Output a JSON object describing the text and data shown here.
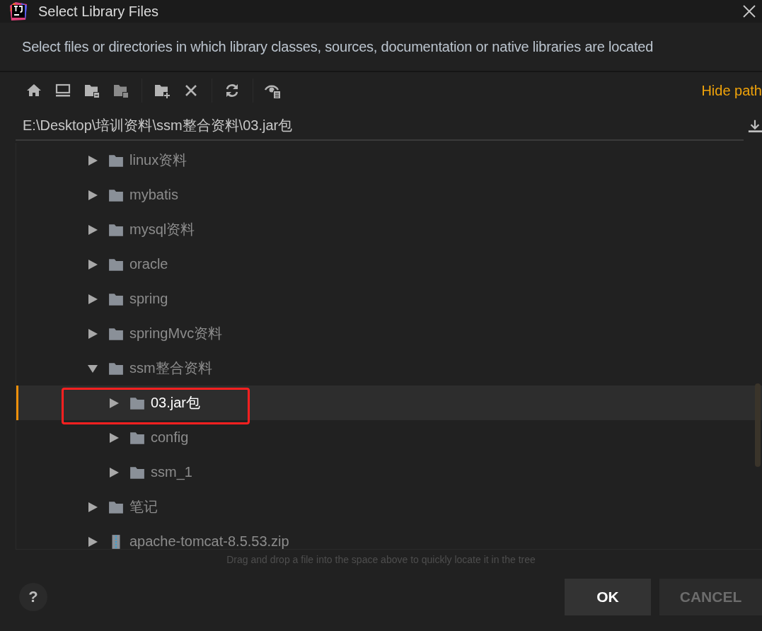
{
  "window": {
    "title": "Select Library Files"
  },
  "description": "Select files or directories in which library classes, sources, documentation or native libraries are located",
  "toolbar": {
    "hide_path_link": "Hide path"
  },
  "path_field": {
    "value": "E:\\Desktop\\培训资料\\ssm整合资料\\03.jar包"
  },
  "tree": {
    "items": [
      {
        "label": "linux资料",
        "kind": "folder",
        "expanded": false,
        "selected": false
      },
      {
        "label": "mybatis",
        "kind": "folder",
        "expanded": false,
        "selected": false
      },
      {
        "label": "mysql资料",
        "kind": "folder",
        "expanded": false,
        "selected": false
      },
      {
        "label": "oracle",
        "kind": "folder",
        "expanded": false,
        "selected": false
      },
      {
        "label": "spring",
        "kind": "folder",
        "expanded": false,
        "selected": false
      },
      {
        "label": "springMvc资料",
        "kind": "folder",
        "expanded": false,
        "selected": false
      },
      {
        "label": "ssm整合资料",
        "kind": "folder",
        "expanded": true,
        "selected": false,
        "children": [
          {
            "label": "03.jar包",
            "kind": "folder",
            "expanded": false,
            "selected": true
          },
          {
            "label": "config",
            "kind": "folder",
            "expanded": false,
            "selected": false
          },
          {
            "label": "ssm_1",
            "kind": "folder",
            "expanded": false,
            "selected": false
          }
        ]
      },
      {
        "label": "笔记",
        "kind": "folder",
        "expanded": false,
        "selected": false
      },
      {
        "label": "apache-tomcat-8.5.53.zip",
        "kind": "archive",
        "expanded": false,
        "selected": false
      }
    ]
  },
  "hint": "Drag and drop a file into the space above to quickly locate it in the tree",
  "help_button": "?",
  "buttons": [
    {
      "label": "OK",
      "disabled": false
    },
    {
      "label": "CANCEL",
      "disabled": true
    }
  ]
}
